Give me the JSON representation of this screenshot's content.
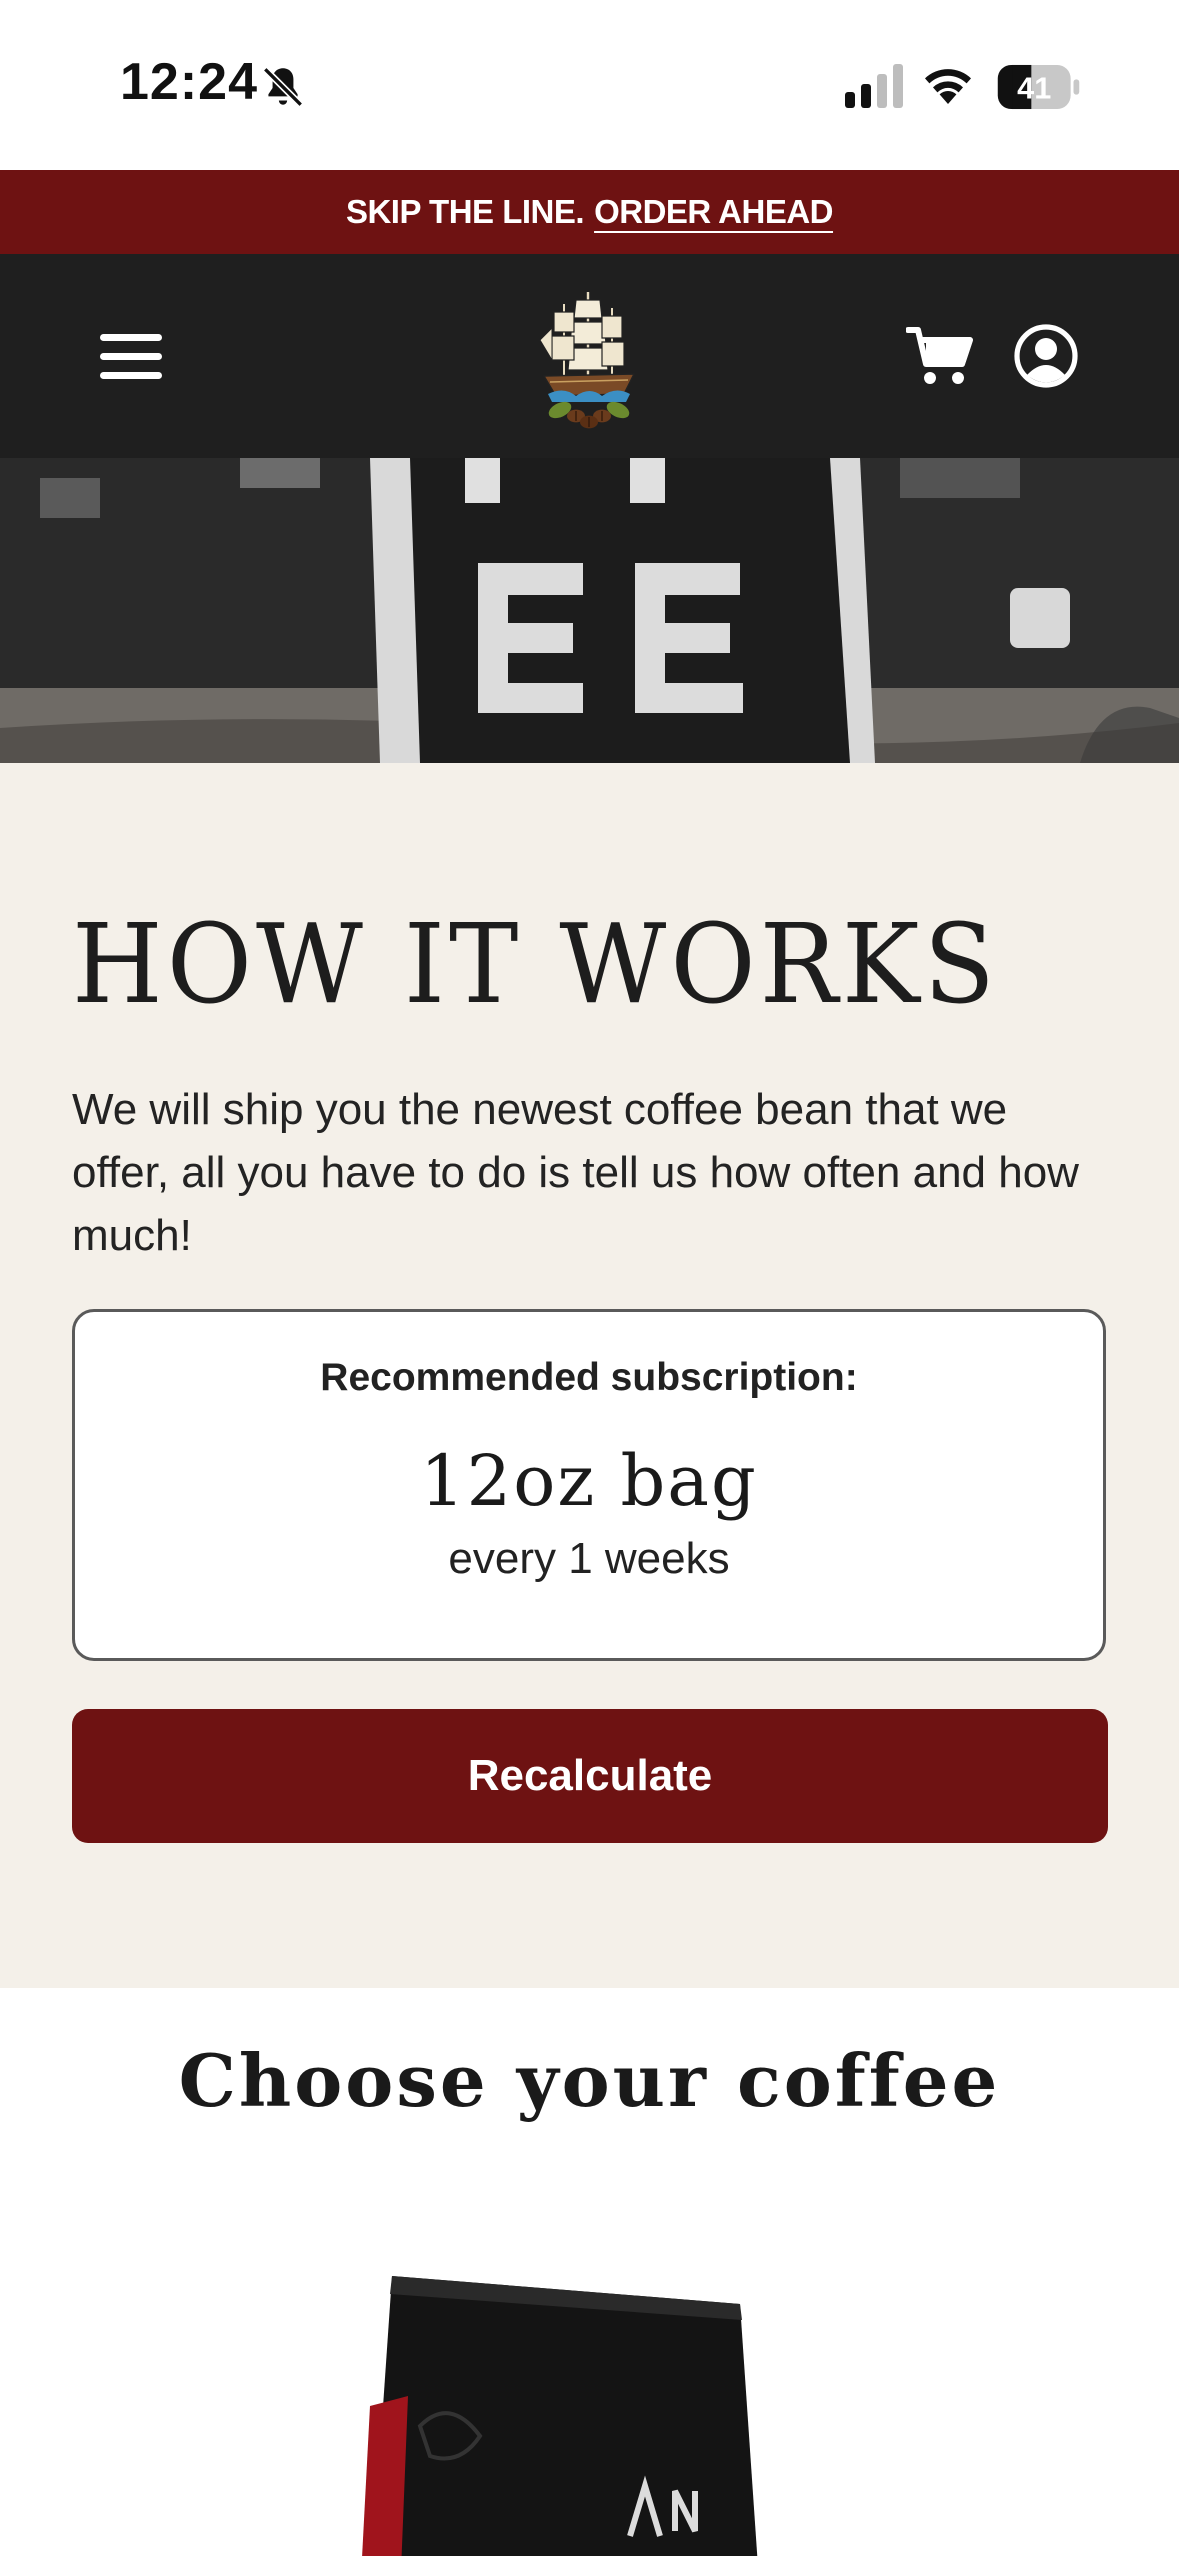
{
  "status_bar": {
    "time": "12:24",
    "battery": "41",
    "icons": [
      "bell-off-icon",
      "cellular-signal-icon",
      "wifi-icon",
      "battery-icon"
    ]
  },
  "promo": {
    "text": "SKIP THE LINE.",
    "link": "ORDER AHEAD"
  },
  "header": {
    "icons": [
      "menu-icon",
      "ship-logo",
      "cart-icon",
      "account-icon"
    ]
  },
  "how_it_works": {
    "title": "HOW IT WORKS",
    "description": "We will ship you the newest coffee bean that we offer, all you have to do is tell us how often and how much!",
    "card": {
      "label": "Recommended subscription:",
      "size": "12oz bag",
      "frequency": "every 1 weeks"
    },
    "button": "Recalculate"
  },
  "choose": {
    "title": "Choose your coffee"
  },
  "colors": {
    "brand_red": "#6e1212",
    "header_bg": "#1f1f1f",
    "section_bg": "#f4f0e9"
  }
}
